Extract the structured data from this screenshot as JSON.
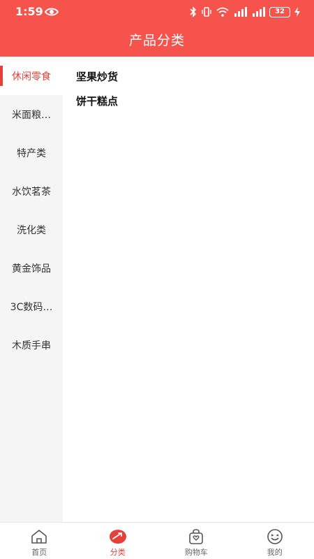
{
  "status_bar": {
    "time": "1:59",
    "battery": "32"
  },
  "header": {
    "title": "产品分类"
  },
  "sidebar": {
    "items": [
      {
        "label": "休闲零食"
      },
      {
        "label": "米面粮…"
      },
      {
        "label": "特产类"
      },
      {
        "label": "水饮茗茶"
      },
      {
        "label": "洗化类"
      },
      {
        "label": "黄金饰品"
      },
      {
        "label": "3C数码…"
      },
      {
        "label": "木质手串"
      }
    ],
    "active_index": 0
  },
  "content": {
    "subcategories": [
      {
        "label": "坚果炒货"
      },
      {
        "label": "饼干糕点"
      }
    ]
  },
  "tabbar": {
    "tabs": [
      {
        "label": "首页",
        "icon": "home-icon"
      },
      {
        "label": "分类",
        "icon": "category-icon"
      },
      {
        "label": "购物车",
        "icon": "cart-bag-icon"
      },
      {
        "label": "我的",
        "icon": "smiley-icon"
      }
    ],
    "active_index": 1
  },
  "colors": {
    "brand": "#f5534b",
    "accent": "#e5403a"
  }
}
